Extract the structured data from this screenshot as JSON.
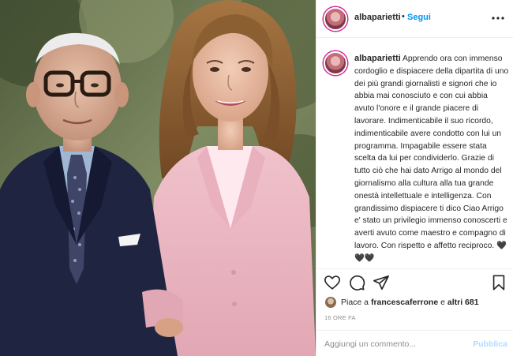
{
  "post": {
    "username": "albaparietti",
    "follow_label": "Segui",
    "dot": "•",
    "caption": "Apprendo ora con immenso cordoglio e dispiacere della dipartita di uno dei più grandi giornalisti e signori che io abbia mai conosciuto e con cui abbia avuto l'onore e il grande piacere di lavorare. Indimenticabile il suo ricordo, indimenticabile avere condotto con lui un programma. Impagabile essere stata scelta da lui per condividerlo. Grazie di tutto ciò che hai dato Arrigo al mondo del giornalismo alla cultura alla tua grande onestà intellettuale e intelligenza. Con grandissimo dispiacere ti dico Ciao Arrigo e' stato un privilegio immenso conoscerti e averti avuto come maestro e compagno di lavoro. Con rispetto e affetto reciproco. 🖤🖤🖤",
    "likes": {
      "prefix": "Piace a ",
      "user": "francescaferrone",
      "connector": " e ",
      "others": "altri 681"
    },
    "time": "16 ORE FA",
    "comment_placeholder": "Aggiungi un commento...",
    "publish_label": "Pubblica"
  },
  "icons": {
    "more": "more-horizontal-icon",
    "like": "heart-icon",
    "comment": "comment-icon",
    "share": "share-icon",
    "save": "bookmark-icon"
  },
  "colors": {
    "accent": "#0095f6",
    "publish_disabled": "#b3dbff",
    "muted": "#8e8e8e",
    "text": "#262626"
  }
}
